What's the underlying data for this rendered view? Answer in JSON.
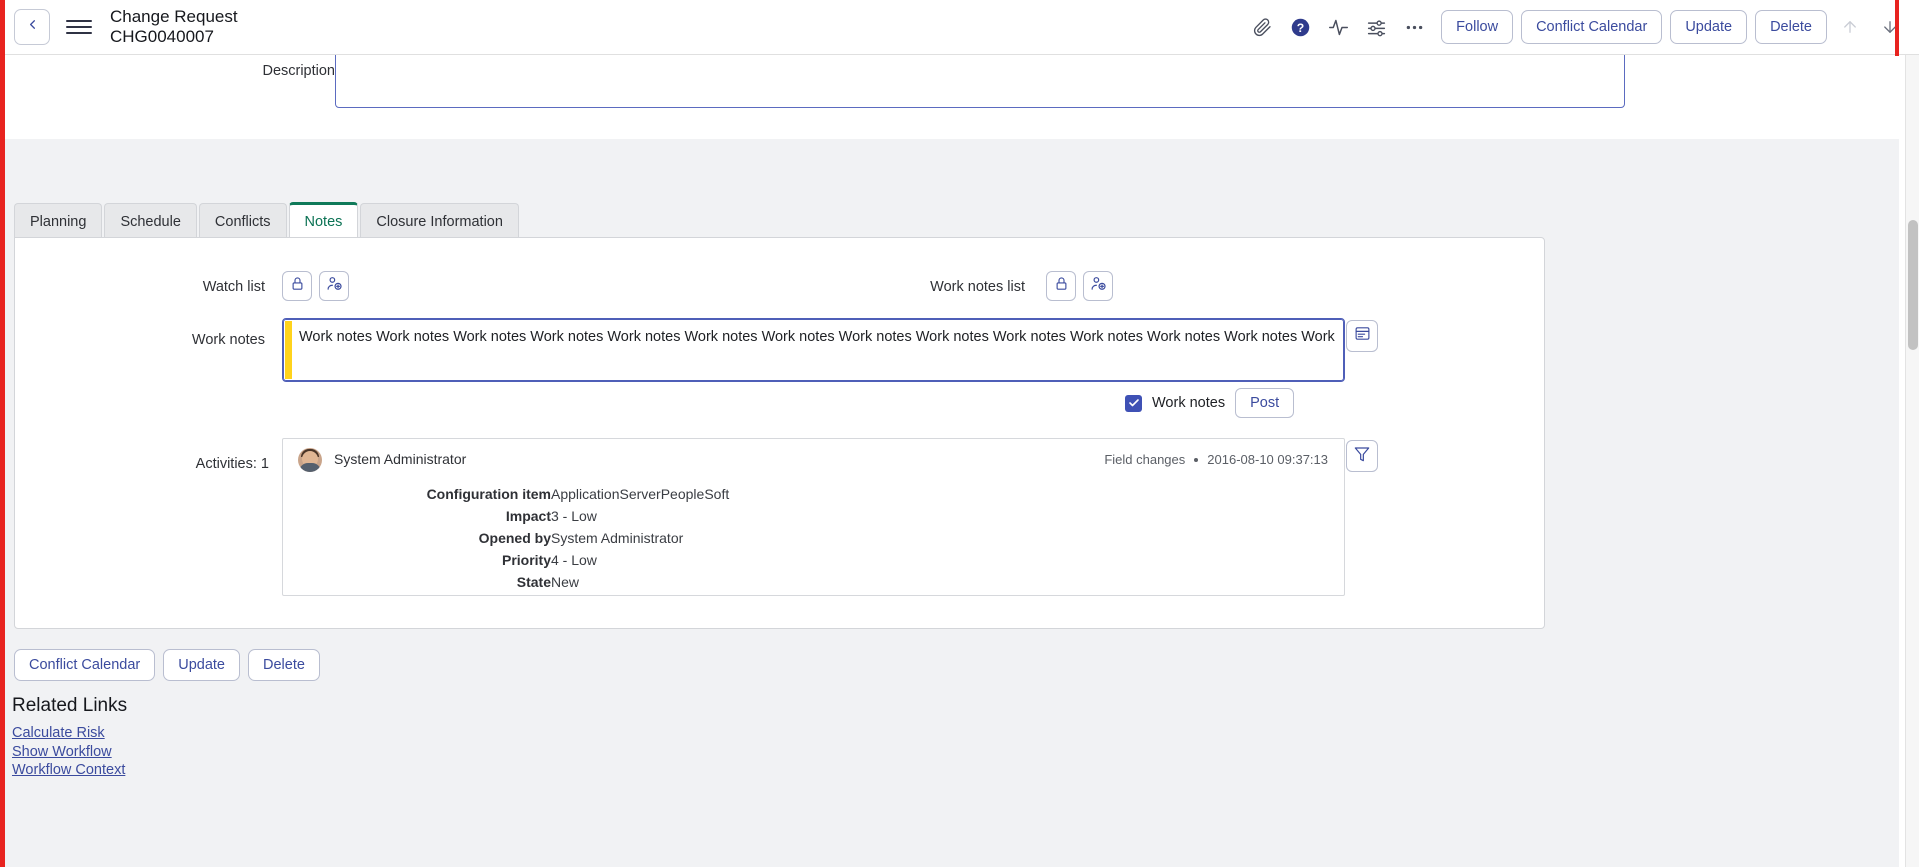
{
  "header": {
    "back_icon": "chevron-left-icon",
    "menu_icon": "hamburger-icon",
    "title_line1": "Change Request",
    "title_line2": "CHG0040007",
    "icons": [
      {
        "name": "attachment-icon",
        "glyph": "paperclip"
      },
      {
        "name": "help-icon",
        "glyph": "question-circle"
      },
      {
        "name": "activity-icon",
        "glyph": "pulse"
      },
      {
        "name": "personalize-icon",
        "glyph": "sliders"
      },
      {
        "name": "more-options-icon",
        "glyph": "ellipsis"
      }
    ],
    "buttons": [
      {
        "name": "follow-button",
        "label": "Follow"
      },
      {
        "name": "conflict-calendar-button",
        "label": "Conflict Calendar"
      },
      {
        "name": "update-button",
        "label": "Update"
      },
      {
        "name": "delete-button",
        "label": "Delete"
      }
    ],
    "nav_up_icon": "arrow-up-icon",
    "nav_down_icon": "arrow-down-icon"
  },
  "form": {
    "description_label": "Description",
    "description_value": ""
  },
  "tabs": [
    {
      "label": "Planning",
      "active": false
    },
    {
      "label": "Schedule",
      "active": false
    },
    {
      "label": "Conflicts",
      "active": false
    },
    {
      "label": "Notes",
      "active": true
    },
    {
      "label": "Closure Information",
      "active": false
    }
  ],
  "notes": {
    "watch_list_label": "Watch list",
    "watch_list_lock_icon": "lock-icon",
    "watch_list_add_icon": "add-user-icon",
    "work_notes_list_label": "Work notes list",
    "work_notes_list_lock_icon": "lock-icon",
    "work_notes_list_add_icon": "add-user-icon",
    "work_notes_label": "Work notes",
    "work_notes_value": "Work notes Work notes Work notes Work notes Work notes Work notes Work notes Work notes Work notes Work notes Work notes Work notes Work notes Work",
    "work_notes_template_icon": "template-icon",
    "post_checkbox_label": "Work notes",
    "post_checkbox_checked": true,
    "post_button_label": "Post",
    "accent_bar_color": "#ffd31c",
    "focus_border_color": "#4f5fb8"
  },
  "activities": {
    "label": "Activities: 1",
    "filter_icon": "filter-icon",
    "entries": [
      {
        "user": "System Administrator",
        "avatar": "user-avatar",
        "type": "Field changes",
        "timestamp": "2016-08-10 09:37:13",
        "fields": [
          {
            "key": "Configuration item",
            "value": "ApplicationServerPeopleSoft"
          },
          {
            "key": "Impact",
            "value": "3 - Low"
          },
          {
            "key": "Opened by",
            "value": "System Administrator"
          },
          {
            "key": "Priority",
            "value": "4 - Low"
          },
          {
            "key": "State",
            "value": "New"
          }
        ]
      }
    ]
  },
  "footer": {
    "buttons": [
      {
        "name": "conflict-calendar-button-bottom",
        "label": "Conflict Calendar"
      },
      {
        "name": "update-button-bottom",
        "label": "Update"
      },
      {
        "name": "delete-button-bottom",
        "label": "Delete"
      }
    ],
    "related_links_title": "Related Links",
    "related_links": [
      "Calculate Risk",
      "Show Workflow",
      "Workflow Context"
    ]
  },
  "theme": {
    "accent": "#3b4b9e",
    "active_tab": "#0f7a59",
    "rail": "#e8231f"
  }
}
